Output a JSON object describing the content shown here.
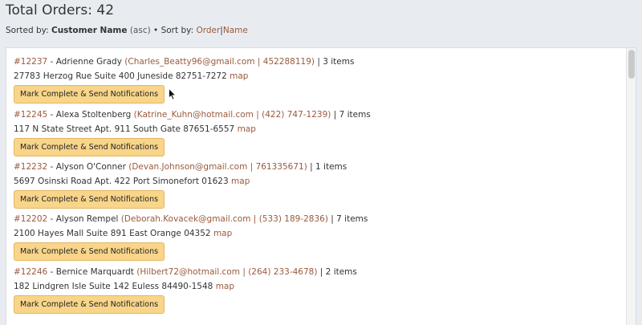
{
  "page": {
    "title": "Total Orders: 42",
    "sort_prefix": "Sorted by:",
    "sort_field": "Customer Name",
    "sort_dir": "(asc)",
    "sort_sep": "•",
    "sort_by_label": "Sort by:",
    "sort_options": [
      "Order",
      "Name"
    ],
    "sort_option_sep": "|"
  },
  "orders": [
    {
      "id": "#12237",
      "name": "Adrienne Grady",
      "email": "Charles_Beatty96@gmail.com",
      "phone": "452288119",
      "items": "3 items",
      "address": "27783 Herzog Rue Suite 400 Juneside 82751-7272",
      "map_label": "map",
      "button_label": "Mark Complete & Send Notifications"
    },
    {
      "id": "#12245",
      "name": "Alexa Stoltenberg",
      "email": "Katrine_Kuhn@hotmail.com",
      "phone": "(422) 747-1239",
      "items": "7 items",
      "address": "117 N State Street Apt. 911 South Gate 87651-6557",
      "map_label": "map",
      "button_label": "Mark Complete & Send Notifications"
    },
    {
      "id": "#12232",
      "name": "Alyson O'Conner",
      "email": "Devan.Johnson@gmail.com",
      "phone": "761335671",
      "items": "1 items",
      "address": "5697 Osinski Road Apt. 422 Port Simonefort 01623",
      "map_label": "map",
      "button_label": "Mark Complete & Send Notifications"
    },
    {
      "id": "#12202",
      "name": "Alyson Rempel",
      "email": "Deborah.Kovacek@gmail.com",
      "phone": "(533) 189-2836",
      "items": "7 items",
      "address": "2100 Hayes Mall Suite 891 East Orange 04352",
      "map_label": "map",
      "button_label": "Mark Complete & Send Notifications"
    },
    {
      "id": "#12246",
      "name": "Bernice Marquardt",
      "email": "Hilbert72@hotmail.com",
      "phone": "(264) 233-4678",
      "items": "2 items",
      "address": "182 Lindgren Isle Suite 142 Euless 84490-1548",
      "map_label": "map",
      "button_label": "Mark Complete & Send Notifications"
    }
  ],
  "colors": {
    "link": "#9a5a3c",
    "button_bg": "#f9d58a",
    "page_bg": "#e8ecf1"
  },
  "icons": {
    "cursor": "mouse-pointer-icon"
  }
}
